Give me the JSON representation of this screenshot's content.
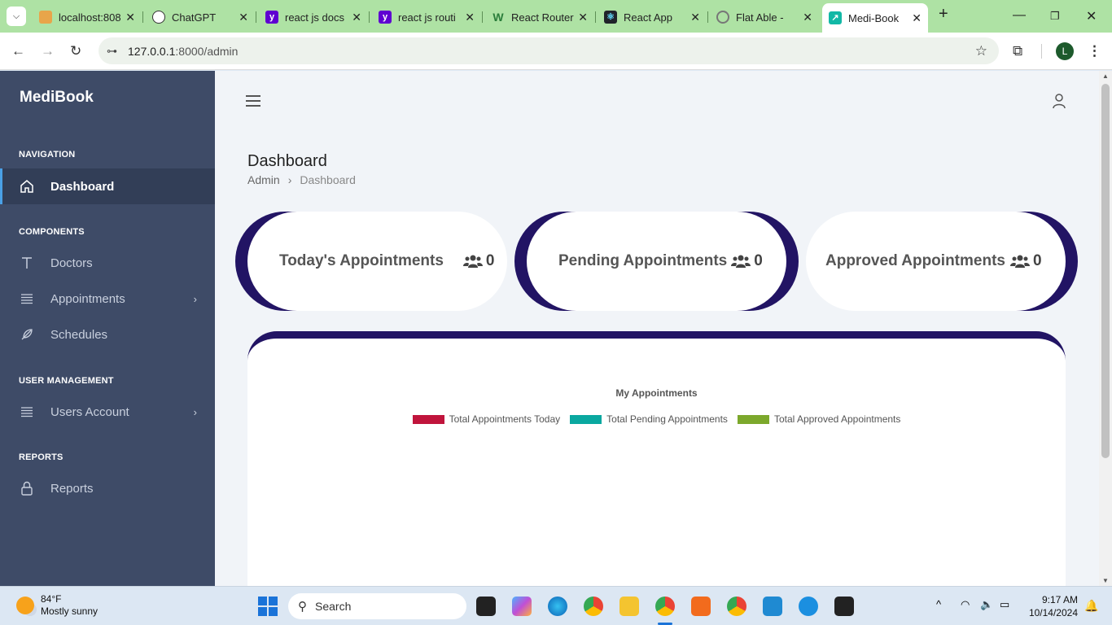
{
  "browser": {
    "tabs": [
      {
        "title": "localhost:808",
        "favicon_color": "#e8a54a"
      },
      {
        "title": "ChatGPT",
        "favicon_color": "#333333"
      },
      {
        "title": "react js docs",
        "favicon_color": "#5f01d1"
      },
      {
        "title": "react js routi",
        "favicon_color": "#5f01d1"
      },
      {
        "title": "React Router",
        "favicon_color": "#2a7d3a"
      },
      {
        "title": "React App",
        "favicon_color": "#20232a"
      },
      {
        "title": "Flat Able - P",
        "favicon_color": "#777777"
      },
      {
        "title": "Medi-Book",
        "favicon_color": "#12b8a6"
      }
    ],
    "url_host": "127.0.0.1",
    "url_path": ":8000/admin",
    "profile_initial": "L"
  },
  "sidebar": {
    "brand": "MediBook",
    "sections": {
      "navigation": "NAVIGATION",
      "components": "COMPONENTS",
      "user_management": "USER MANAGEMENT",
      "reports": "REPORTS"
    },
    "items": {
      "dashboard": "Dashboard",
      "doctors": "Doctors",
      "appointments": "Appointments",
      "schedules": "Schedules",
      "users_account": "Users Account",
      "reports": "Reports"
    }
  },
  "main": {
    "page_title": "Dashboard",
    "breadcrumb": {
      "root": "Admin",
      "current": "Dashboard"
    },
    "cards": [
      {
        "label": "Today's Appointments",
        "count": "0"
      },
      {
        "label": "Pending Appointments",
        "count": "0"
      },
      {
        "label": "Approved Appointments",
        "count": "0"
      }
    ],
    "accent": "#221464"
  },
  "chart_data": {
    "type": "bar",
    "title": "My Appointments",
    "categories": [],
    "series": [
      {
        "name": "Total Appointments Today",
        "color": "#c0143c",
        "values": []
      },
      {
        "name": "Total Pending Appointments",
        "color": "#0aa8a0",
        "values": []
      },
      {
        "name": "Total Approved Appointments",
        "color": "#7ca82c",
        "values": []
      }
    ]
  },
  "taskbar": {
    "weather_temp": "84°F",
    "weather_desc": "Mostly sunny",
    "search_placeholder": "Search",
    "time": "9:17 AM",
    "date": "10/14/2024"
  }
}
